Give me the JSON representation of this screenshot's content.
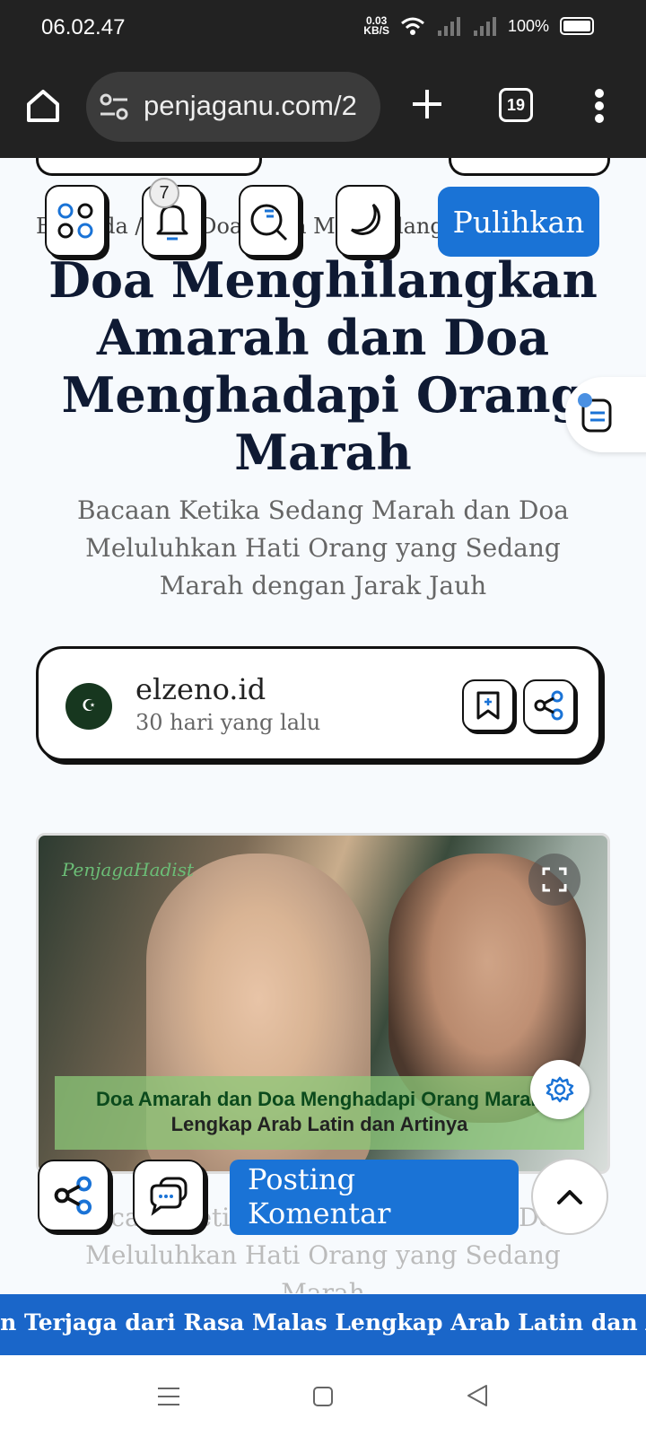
{
  "status_bar": {
    "time": "06.02.47",
    "net_speed_value": "0.03",
    "net_speed_unit": "KB/S",
    "battery": "100%"
  },
  "browser": {
    "url": "penjaganu.com/2",
    "tab_count": "19"
  },
  "article": {
    "breadcrumb": "Beranda / Doa-Doa / Doa Menghilangkan ...",
    "notification_count": "7",
    "restore_label": "Pulihkan",
    "title": "Doa Menghilangkan Amarah dan Doa Menghadapi Orang Marah",
    "subtitle": "Bacaan Ketika Sedang Marah dan Doa Meluluhkan Hati Orang yang Sedang Marah dengan Jarak Jauh"
  },
  "author": {
    "name": "elzeno.id",
    "time_ago": "30 hari yang lalu"
  },
  "hero": {
    "watermark": "PenjagaHadist",
    "caption_line1": "Doa Amarah dan Doa Menghadapi Orang Marah",
    "caption_line2": "Lengkap Arab Latin dan Artinya"
  },
  "body_preview": "Bacaan Ketika Sedang Marah dan Doa Meluluhkan Hati Orang yang Sedang Marah",
  "bottom_actions": {
    "post_comment_label": "Posting Komentar"
  },
  "ticker": {
    "text": "Doa Agar Terhindar dan Terjaga dari Rasa Malas Lengkap Arab Latin dan Artinya"
  },
  "colors": {
    "accent": "#1a73d6",
    "ticker_bg": "#1a66c9",
    "title": "#0f1a33"
  }
}
